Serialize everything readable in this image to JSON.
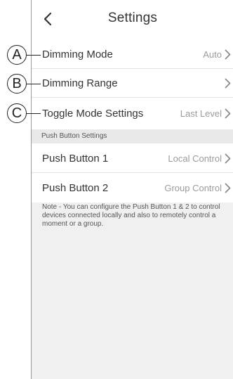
{
  "header": {
    "title": "Settings"
  },
  "rows": [
    {
      "label": "Dimming Mode",
      "value": "Auto"
    },
    {
      "label": "Dimming Range",
      "value": ""
    },
    {
      "label": "Toggle Mode Settings",
      "value": "Last Level"
    }
  ],
  "section": {
    "title": "Push Button Settings"
  },
  "push_rows": [
    {
      "label": "Push Button 1",
      "value": "Local Control"
    },
    {
      "label": "Push Button 2",
      "value": "Group Control"
    }
  ],
  "note": "Note - You can configure the Push Button 1 & 2 to control devices connected locally and also to remotely control a moment or a group.",
  "callouts": [
    "A",
    "B",
    "C"
  ],
  "icons": {
    "back": "back-chevron-icon",
    "row": "chevron-right-icon"
  },
  "colors": {
    "background": "#f0f0f0",
    "text": "#333333",
    "secondary_text": "#9b9b9b"
  }
}
